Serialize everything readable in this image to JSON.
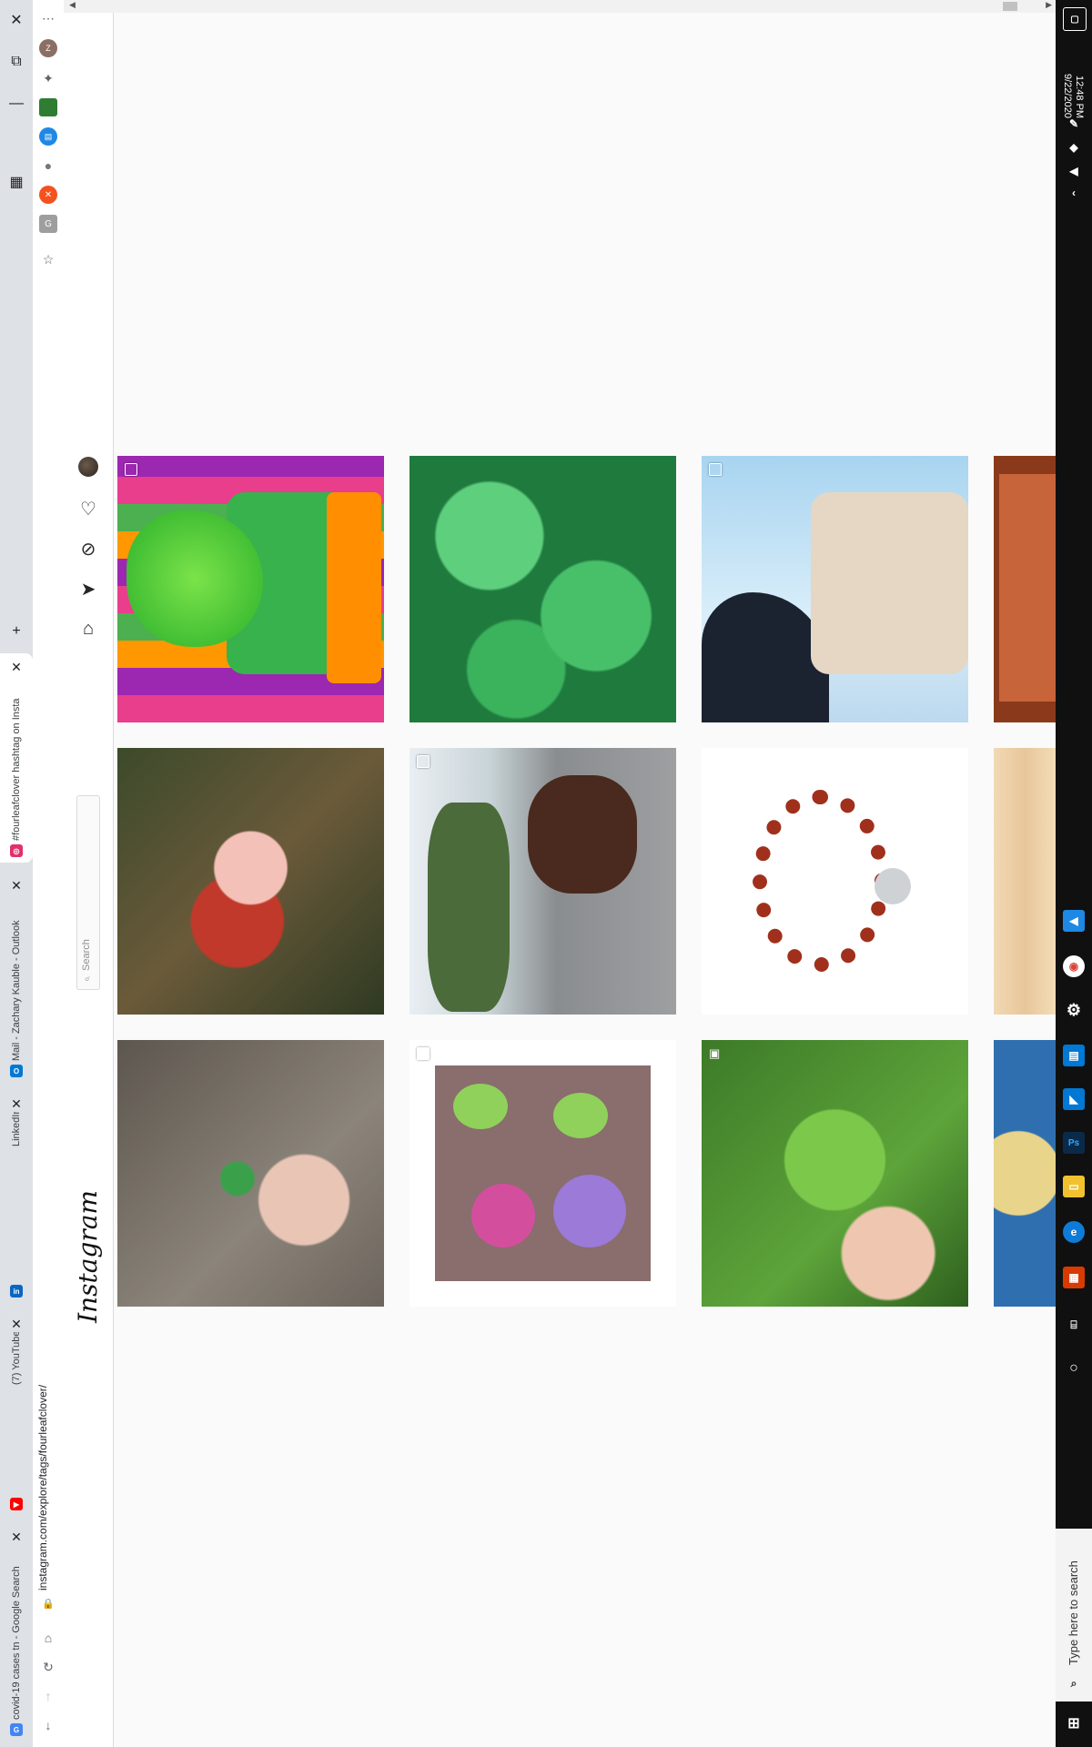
{
  "browser": {
    "tabs": [
      {
        "title": "covid-19 cases tn - Google Search",
        "favicon": "google-icon",
        "color": "#4285f4"
      },
      {
        "title": "(7) YouTube",
        "favicon": "youtube-icon",
        "color": "#ff0000"
      },
      {
        "title": "LinkedIn",
        "favicon": "linkedin-icon",
        "color": "#0a66c2"
      },
      {
        "title": "Mail - Zachary Kauble - Outlook",
        "favicon": "outlook-icon",
        "color": "#0078d4"
      },
      {
        "title": "#fourleafclover hashtag on Insta",
        "favicon": "instagram-icon",
        "color": "#e1306c"
      }
    ],
    "new_tab": "+",
    "close_glyph": "✕",
    "url": "instagram.com/explore/tags/fourleafclover/"
  },
  "instagram": {
    "logo": "Instagram",
    "search_placeholder": "Search",
    "nav_icons": [
      "home-icon",
      "direct-icon",
      "explore-icon",
      "activity-heart-icon",
      "profile-avatar"
    ]
  },
  "taskbar": {
    "time": "12:48 PM",
    "date": "9/22/2020",
    "search_placeholder": "Type here to search",
    "app_icons": [
      "cortana-icon",
      "task-view-icon",
      "office-icon",
      "edge-icon",
      "file-explorer-icon",
      "photoshop-icon",
      "mail-icon",
      "teams-icon",
      "settings-icon",
      "chrome-icon",
      "code-icon"
    ]
  },
  "grid": {
    "posts": [
      {
        "name": "post-leprechaun-hat",
        "multi": true
      },
      {
        "name": "post-clover-patch",
        "multi": false
      },
      {
        "name": "post-anime-character",
        "multi": true
      },
      {
        "name": "post-partial-1",
        "multi": false
      },
      {
        "name": "post-leprechaun-plush",
        "multi": false
      },
      {
        "name": "post-horse-rider",
        "multi": true
      },
      {
        "name": "post-bracelet",
        "multi": false
      },
      {
        "name": "post-partial-2",
        "multi": false
      },
      {
        "name": "post-hand-clover",
        "multi": false
      },
      {
        "name": "post-crochet-pots",
        "multi": true
      },
      {
        "name": "post-clover-closeup",
        "multi": false,
        "camera": true
      },
      {
        "name": "post-partial-3",
        "multi": false
      }
    ]
  }
}
